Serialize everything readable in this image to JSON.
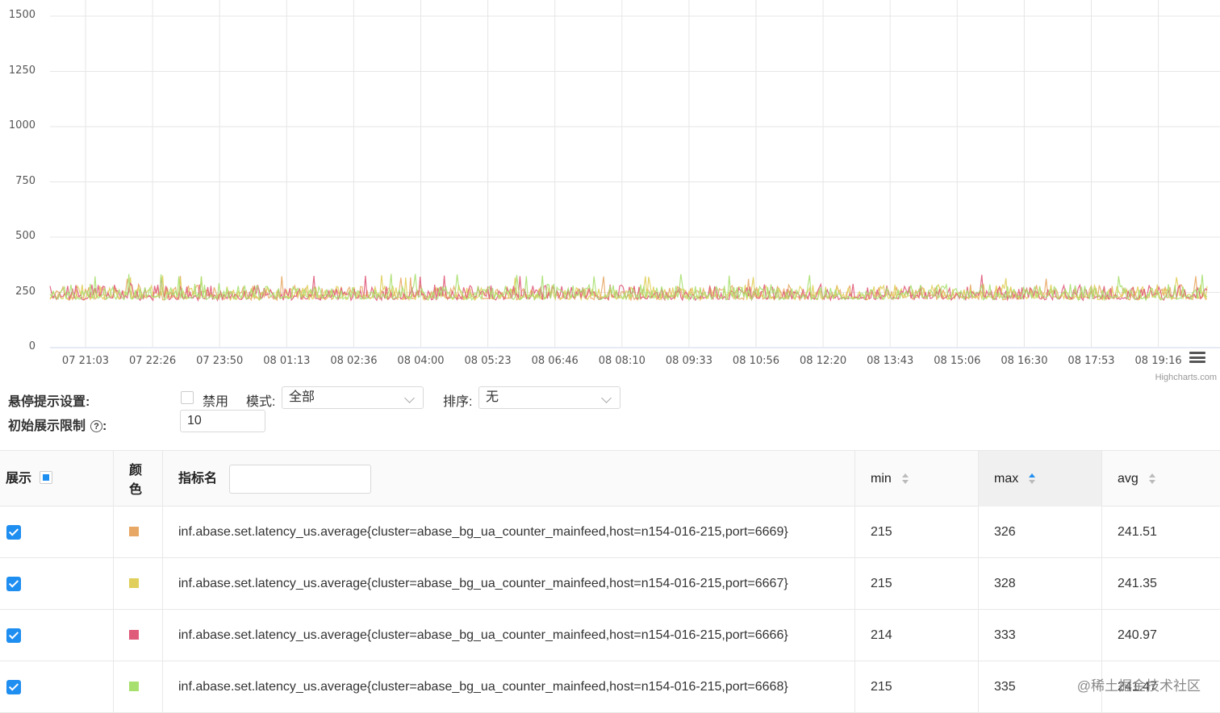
{
  "chart_data": {
    "type": "line",
    "title": "",
    "xlabel": "",
    "ylabel": "",
    "ylim": [
      0,
      1500
    ],
    "yticks": [
      0,
      250,
      500,
      750,
      1000,
      1250,
      1500
    ],
    "xtick_labels": [
      "07 21:03",
      "07 22:26",
      "07 23:50",
      "08 01:13",
      "08 02:36",
      "08 04:00",
      "08 05:23",
      "08 06:46",
      "08 08:10",
      "08 09:33",
      "08 10:56",
      "08 12:20",
      "08 13:43",
      "08 15:06",
      "08 16:30",
      "08 17:53",
      "08 19:16"
    ],
    "grid": true,
    "legend": "none",
    "series": [
      {
        "color": "#e8a865",
        "min": 215,
        "max": 326,
        "avg": 241.51
      },
      {
        "color": "#e0cf5a",
        "min": 215,
        "max": 328,
        "avg": 241.35
      },
      {
        "color": "#e05a7a",
        "min": 214,
        "max": 333,
        "avg": 240.97
      },
      {
        "color": "#a8e070",
        "min": 215,
        "max": 335,
        "avg": 241.47
      }
    ]
  },
  "chart": {
    "credits": "Highcharts.com",
    "menu_icon": "hamburger-menu-icon"
  },
  "settings": {
    "hover_label": "悬停提示设置:",
    "disable_label": "禁用",
    "mode_label": "模式:",
    "mode_value": "全部",
    "sort_label": "排序:",
    "sort_value": "无",
    "limit_label": "初始展示限制",
    "limit_value": "10"
  },
  "table": {
    "headers": {
      "show": "展示",
      "color_line1": "颜",
      "color_line2": "色",
      "name": "指标名",
      "min": "min",
      "max": "max",
      "avg": "avg"
    },
    "rows": [
      {
        "color": "#e8a865",
        "name": "inf.abase.set.latency_us.average{cluster=abase_bg_ua_counter_mainfeed,host=n154-016-215,port=6669}",
        "min": "215",
        "max": "326",
        "avg": "241.51"
      },
      {
        "color": "#e0cf5a",
        "name": "inf.abase.set.latency_us.average{cluster=abase_bg_ua_counter_mainfeed,host=n154-016-215,port=6667}",
        "min": "215",
        "max": "328",
        "avg": "241.35"
      },
      {
        "color": "#e05a7a",
        "name": "inf.abase.set.latency_us.average{cluster=abase_bg_ua_counter_mainfeed,host=n154-016-215,port=6666}",
        "min": "214",
        "max": "333",
        "avg": "240.97"
      },
      {
        "color": "#a8e070",
        "name": "inf.abase.set.latency_us.average{cluster=abase_bg_ua_counter_mainfeed,host=n154-016-215,port=6668}",
        "min": "215",
        "max": "335",
        "avg": "241.47"
      }
    ]
  },
  "watermark": "@稀土掘金技术社区"
}
